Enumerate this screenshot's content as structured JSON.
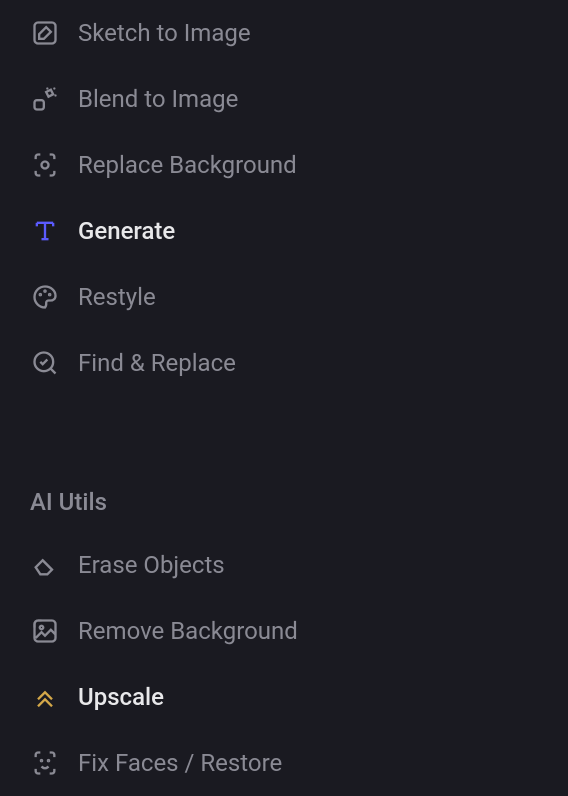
{
  "colors": {
    "icon_default": "#8a8a94",
    "icon_accent_blue": "#5b5bff",
    "icon_accent_gold": "#d4a849",
    "text_default": "#8a8a94",
    "text_highlighted": "#e8e8ea"
  },
  "sections": {
    "main": {
      "items": [
        {
          "label": "Sketch to Image",
          "highlighted": false,
          "icon": "sketch-icon"
        },
        {
          "label": "Blend to Image",
          "highlighted": false,
          "icon": "blend-icon"
        },
        {
          "label": "Replace Background",
          "highlighted": false,
          "icon": "replace-bg-icon"
        },
        {
          "label": "Generate",
          "highlighted": true,
          "icon": "text-icon"
        },
        {
          "label": "Restyle",
          "highlighted": false,
          "icon": "palette-icon"
        },
        {
          "label": "Find & Replace",
          "highlighted": false,
          "icon": "find-icon"
        }
      ]
    },
    "utils": {
      "header": "AI Utils",
      "items": [
        {
          "label": "Erase Objects",
          "highlighted": false,
          "icon": "erase-icon"
        },
        {
          "label": "Remove Background",
          "highlighted": false,
          "icon": "remove-bg-icon"
        },
        {
          "label": "Upscale",
          "highlighted": true,
          "icon": "upscale-icon"
        },
        {
          "label": "Fix Faces / Restore",
          "highlighted": false,
          "icon": "face-icon"
        }
      ]
    }
  }
}
